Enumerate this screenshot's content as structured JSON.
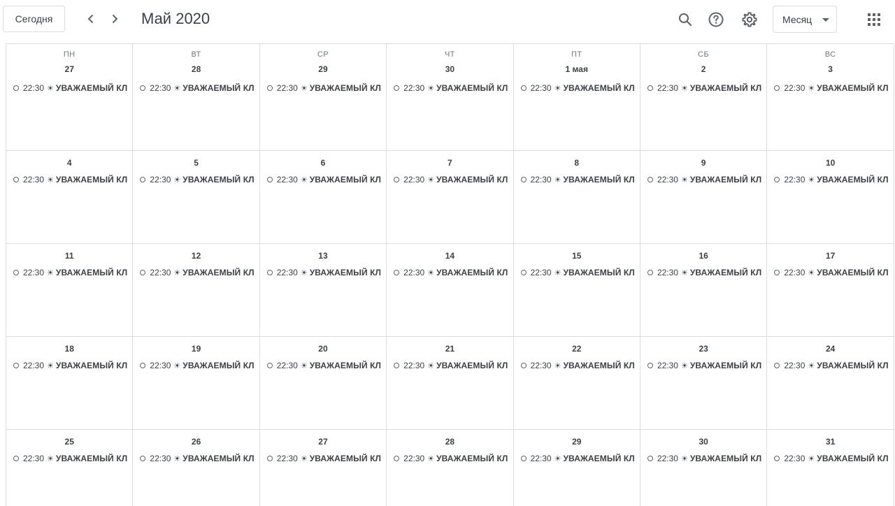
{
  "header": {
    "today_label": "Сегодня",
    "title": "Май 2020",
    "view_label": "Месяц"
  },
  "icons": {
    "prev": "chevron-left-icon",
    "next": "chevron-right-icon",
    "search": "search-icon",
    "help": "help-icon",
    "settings": "gear-icon",
    "apps": "apps-grid-icon"
  },
  "weekdays": [
    "ПН",
    "ВТ",
    "СР",
    "ЧТ",
    "ПТ",
    "СБ",
    "ВС"
  ],
  "event": {
    "time": "22:30",
    "symbol": "☀",
    "title": "УВАЖАЕМЫЙ КЛ"
  },
  "weeks": [
    [
      "27",
      "28",
      "29",
      "30",
      "1 мая",
      "2",
      "3"
    ],
    [
      "4",
      "5",
      "6",
      "7",
      "8",
      "9",
      "10"
    ],
    [
      "11",
      "12",
      "13",
      "14",
      "15",
      "16",
      "17"
    ],
    [
      "18",
      "19",
      "20",
      "21",
      "22",
      "23",
      "24"
    ],
    [
      "25",
      "26",
      "27",
      "28",
      "29",
      "30",
      "31"
    ]
  ]
}
